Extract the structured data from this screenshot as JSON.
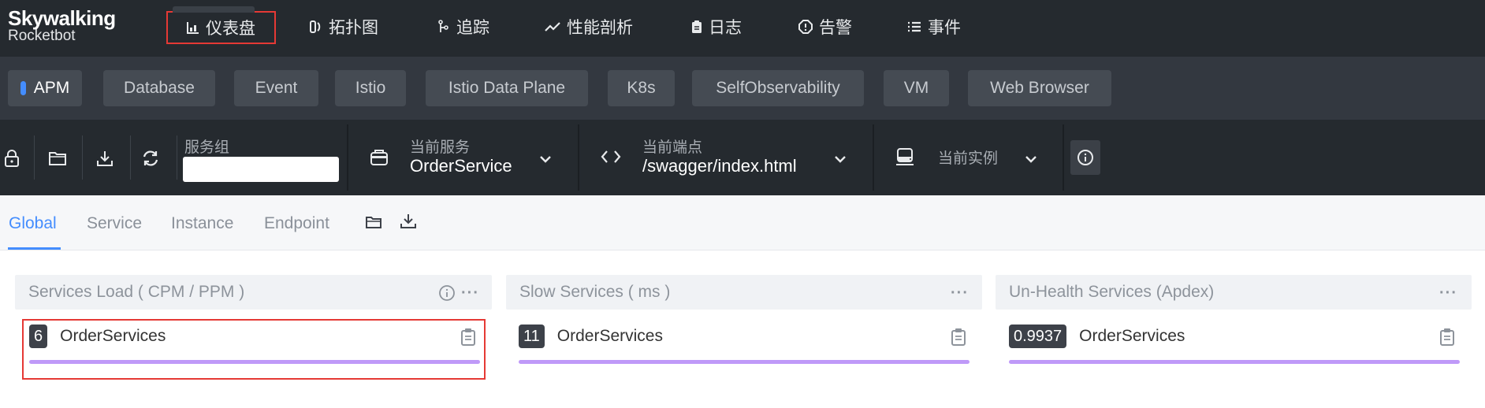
{
  "brand": {
    "name_top": "Skywalking",
    "name_bottom": "Rocketbot"
  },
  "nav": [
    {
      "label": "仪表盘",
      "icon": "bar-chart-icon",
      "active": true
    },
    {
      "label": "拓扑图",
      "icon": "topology-icon"
    },
    {
      "label": "追踪",
      "icon": "trace-icon"
    },
    {
      "label": "性能剖析",
      "icon": "trend-line-icon"
    },
    {
      "label": "日志",
      "icon": "clipboard-icon"
    },
    {
      "label": "告警",
      "icon": "alert-octagon-icon"
    },
    {
      "label": "事件",
      "icon": "list-icon"
    }
  ],
  "layers": [
    {
      "label": "APM",
      "active": true
    },
    {
      "label": "Database"
    },
    {
      "label": "Event"
    },
    {
      "label": "Istio"
    },
    {
      "label": "Istio Data Plane"
    },
    {
      "label": "K8s"
    },
    {
      "label": "SelfObservability"
    },
    {
      "label": "VM"
    },
    {
      "label": "Web Browser"
    }
  ],
  "toolbar": {
    "service_group_label": "服务组",
    "service_group_value": "",
    "current_service_label": "当前服务",
    "current_service_value": "OrderService",
    "current_endpoint_label": "当前端点",
    "current_endpoint_value": "/swagger/index.html",
    "current_instance_label": "当前实例"
  },
  "tabs": [
    {
      "label": "Global",
      "active": true
    },
    {
      "label": "Service"
    },
    {
      "label": "Instance"
    },
    {
      "label": "Endpoint"
    }
  ],
  "panels": [
    {
      "title": "Services Load ( CPM / PPM )",
      "has_info": true,
      "items": [
        {
          "value": "6",
          "name": "OrderServices"
        }
      ]
    },
    {
      "title": "Slow Services ( ms )",
      "has_info": false,
      "items": [
        {
          "value": "11",
          "name": "OrderServices"
        }
      ]
    },
    {
      "title": "Un-Health Services (Apdex)",
      "has_info": false,
      "items": [
        {
          "value": "0.9937",
          "name": "OrderServices"
        }
      ]
    }
  ],
  "colors": {
    "accent": "#448dfe",
    "highlight": "#e53935",
    "bar": "#bf99f8",
    "nav_bg": "#252a2f"
  }
}
